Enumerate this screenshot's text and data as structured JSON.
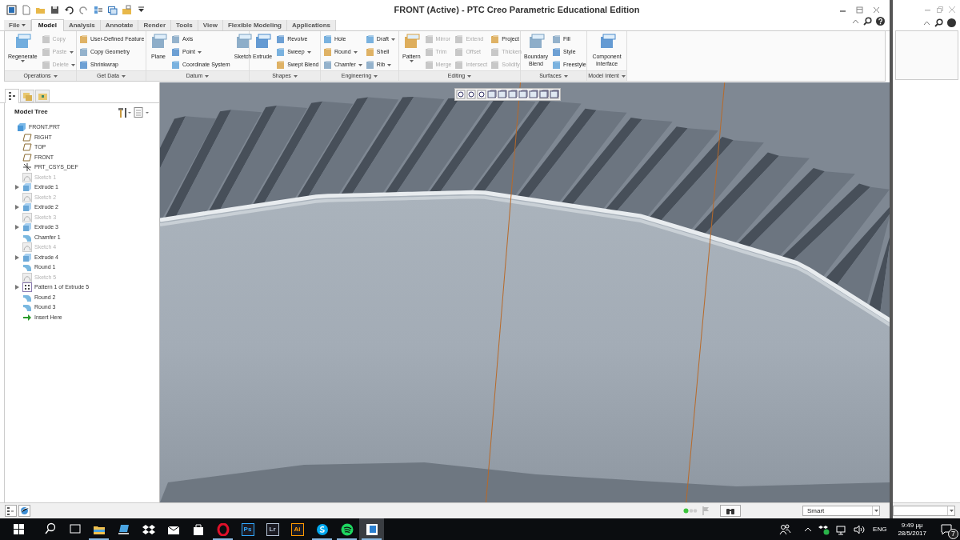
{
  "window": {
    "title": "FRONT (Active) - PTC Creo Parametric Educational Edition"
  },
  "tabs": [
    {
      "label": "File",
      "selected": false,
      "menu": true
    },
    {
      "label": "Model",
      "selected": true,
      "menu": false
    },
    {
      "label": "Analysis",
      "selected": false,
      "menu": false
    },
    {
      "label": "Annotate",
      "selected": false,
      "menu": false
    },
    {
      "label": "Render",
      "selected": false,
      "menu": false
    },
    {
      "label": "Tools",
      "selected": false,
      "menu": false
    },
    {
      "label": "View",
      "selected": false,
      "menu": false
    },
    {
      "label": "Flexible Modeling",
      "selected": false,
      "menu": false
    },
    {
      "label": "Applications",
      "selected": false,
      "menu": false
    }
  ],
  "ribbon": {
    "groups": [
      {
        "label": "Operations",
        "columns": [
          [
            {
              "label": "Regenerate",
              "kind": "large",
              "disabled": false,
              "menu": true
            }
          ],
          [
            {
              "label": "Copy",
              "kind": "small",
              "disabled": true,
              "menu": false
            },
            {
              "label": "Paste",
              "kind": "small",
              "disabled": true,
              "menu": true
            },
            {
              "label": "Delete",
              "kind": "small",
              "disabled": true,
              "menu": true
            }
          ]
        ]
      },
      {
        "label": "Get Data",
        "columns": [
          [
            {
              "label": "User-Defined Feature",
              "kind": "small",
              "disabled": false,
              "menu": false
            },
            {
              "label": "Copy Geometry",
              "kind": "small",
              "disabled": false,
              "menu": false
            },
            {
              "label": "Shrinkwrap",
              "kind": "small",
              "disabled": false,
              "menu": false
            }
          ]
        ]
      },
      {
        "label": "Datum",
        "columns": [
          [
            {
              "label": "Plane",
              "kind": "large",
              "disabled": false,
              "menu": false
            }
          ],
          [
            {
              "label": "Axis",
              "kind": "small",
              "disabled": false,
              "menu": false
            },
            {
              "label": "Point",
              "kind": "small",
              "disabled": false,
              "menu": true
            },
            {
              "label": "Coordinate System",
              "kind": "small",
              "disabled": false,
              "menu": false
            }
          ],
          [
            {
              "label": "Sketch",
              "kind": "large",
              "disabled": false,
              "menu": false
            }
          ]
        ]
      },
      {
        "label": "Shapes",
        "columns": [
          [
            {
              "label": "Extrude",
              "kind": "large",
              "disabled": false,
              "menu": false
            }
          ],
          [
            {
              "label": "Revolve",
              "kind": "small",
              "disabled": false,
              "menu": false
            },
            {
              "label": "Sweep",
              "kind": "small",
              "disabled": false,
              "menu": true
            },
            {
              "label": "Swept Blend",
              "kind": "small",
              "disabled": false,
              "menu": false
            }
          ]
        ]
      },
      {
        "label": "Engineering",
        "columns": [
          [
            {
              "label": "Hole",
              "kind": "small",
              "disabled": false,
              "menu": false
            },
            {
              "label": "Round",
              "kind": "small",
              "disabled": false,
              "menu": true
            },
            {
              "label": "Chamfer",
              "kind": "small",
              "disabled": false,
              "menu": true
            }
          ],
          [
            {
              "label": "Draft",
              "kind": "small",
              "disabled": false,
              "menu": true
            },
            {
              "label": "Shell",
              "kind": "small",
              "disabled": false,
              "menu": false
            },
            {
              "label": "Rib",
              "kind": "small",
              "disabled": false,
              "menu": true
            }
          ]
        ]
      },
      {
        "label": "Editing",
        "columns": [
          [
            {
              "label": "Pattern",
              "kind": "large",
              "disabled": false,
              "menu": true
            }
          ],
          [
            {
              "label": "Mirror",
              "kind": "small",
              "disabled": true,
              "menu": false
            },
            {
              "label": "Trim",
              "kind": "small",
              "disabled": true,
              "menu": false
            },
            {
              "label": "Merge",
              "kind": "small",
              "disabled": true,
              "menu": false
            }
          ],
          [
            {
              "label": "Extend",
              "kind": "small",
              "disabled": true,
              "menu": false
            },
            {
              "label": "Offset",
              "kind": "small",
              "disabled": true,
              "menu": false
            },
            {
              "label": "Intersect",
              "kind": "small",
              "disabled": true,
              "menu": false
            }
          ],
          [
            {
              "label": "Project",
              "kind": "small",
              "disabled": false,
              "menu": false
            },
            {
              "label": "Thicken",
              "kind": "small",
              "disabled": true,
              "menu": false
            },
            {
              "label": "Solidify",
              "kind": "small",
              "disabled": true,
              "menu": false
            }
          ]
        ]
      },
      {
        "label": "Surfaces",
        "columns": [
          [
            {
              "label": "Boundary Blend",
              "kind": "large",
              "disabled": false,
              "menu": false
            }
          ],
          [
            {
              "label": "Fill",
              "kind": "small",
              "disabled": false,
              "menu": false
            },
            {
              "label": "Style",
              "kind": "small",
              "disabled": false,
              "menu": false
            },
            {
              "label": "Freestyle",
              "kind": "small",
              "disabled": false,
              "menu": false
            }
          ]
        ]
      },
      {
        "label": "Model Intent",
        "columns": [
          [
            {
              "label": "Component Interface",
              "kind": "large",
              "disabled": false,
              "menu": false
            }
          ]
        ]
      }
    ]
  },
  "navigator": {
    "tabs": [
      {
        "selected": true
      },
      {
        "selected": false
      },
      {
        "selected": false
      }
    ],
    "title": "Model Tree"
  },
  "model_tree": [
    {
      "label": "FRONT.PRT",
      "kind": "part",
      "dimmed": false,
      "expandable": false,
      "children": [
        {
          "label": "RIGHT",
          "kind": "plane",
          "dimmed": false,
          "expandable": false
        },
        {
          "label": "TOP",
          "kind": "plane",
          "dimmed": false,
          "expandable": false
        },
        {
          "label": "FRONT",
          "kind": "plane",
          "dimmed": false,
          "expandable": false
        },
        {
          "label": "PRT_CSYS_DEF",
          "kind": "csys",
          "dimmed": false,
          "expandable": false
        },
        {
          "label": "Sketch 1",
          "kind": "sketch",
          "dimmed": true,
          "expandable": false
        },
        {
          "label": "Extrude 1",
          "kind": "extrude",
          "dimmed": false,
          "expandable": true
        },
        {
          "label": "Sketch 2",
          "kind": "sketch",
          "dimmed": true,
          "expandable": false
        },
        {
          "label": "Extrude 2",
          "kind": "extrude",
          "dimmed": false,
          "expandable": true
        },
        {
          "label": "Sketch 3",
          "kind": "sketch",
          "dimmed": true,
          "expandable": false
        },
        {
          "label": "Extrude 3",
          "kind": "extrude",
          "dimmed": false,
          "expandable": true
        },
        {
          "label": "Chamfer 1",
          "kind": "round",
          "dimmed": false,
          "expandable": false
        },
        {
          "label": "Sketch 4",
          "kind": "sketch",
          "dimmed": true,
          "expandable": false
        },
        {
          "label": "Extrude 4",
          "kind": "extrude",
          "dimmed": false,
          "expandable": true
        },
        {
          "label": "Round 1",
          "kind": "round",
          "dimmed": false,
          "expandable": false
        },
        {
          "label": "Sketch 5",
          "kind": "sketch",
          "dimmed": true,
          "expandable": false
        },
        {
          "label": "Pattern 1 of Extrude 5",
          "kind": "pattern",
          "dimmed": false,
          "expandable": true
        },
        {
          "label": "Round 2",
          "kind": "round",
          "dimmed": false,
          "expandable": false
        },
        {
          "label": "Round 3",
          "kind": "round",
          "dimmed": false,
          "expandable": false
        },
        {
          "label": "Insert Here",
          "kind": "insert",
          "dimmed": false,
          "expandable": false
        }
      ]
    }
  ],
  "status_bar": {
    "filter": "Smart"
  },
  "taskbar": {
    "apps": [
      {
        "kind": "explorer",
        "running": true,
        "selected": false
      },
      {
        "kind": "computer",
        "running": false,
        "selected": false
      },
      {
        "kind": "dropbox",
        "running": false,
        "selected": false
      },
      {
        "kind": "mail",
        "running": false,
        "selected": false
      },
      {
        "kind": "store",
        "running": false,
        "selected": false
      },
      {
        "kind": "opera",
        "running": true,
        "selected": false
      },
      {
        "kind": "letters",
        "label": "Ps",
        "color": "#31a8ff",
        "running": false,
        "selected": false
      },
      {
        "kind": "letters",
        "label": "Lr",
        "color": "#b6c4d6",
        "running": false,
        "selected": false
      },
      {
        "kind": "letters",
        "label": "Ai",
        "color": "#ff9a00",
        "running": false,
        "selected": false
      },
      {
        "kind": "skype",
        "running": true,
        "selected": false
      },
      {
        "kind": "spotify",
        "running": true,
        "selected": false
      },
      {
        "kind": "creo",
        "running": true,
        "selected": true
      }
    ],
    "language": "ENG",
    "time": "9:49 μμ",
    "date": "28/5/2017",
    "notifications": "7"
  }
}
